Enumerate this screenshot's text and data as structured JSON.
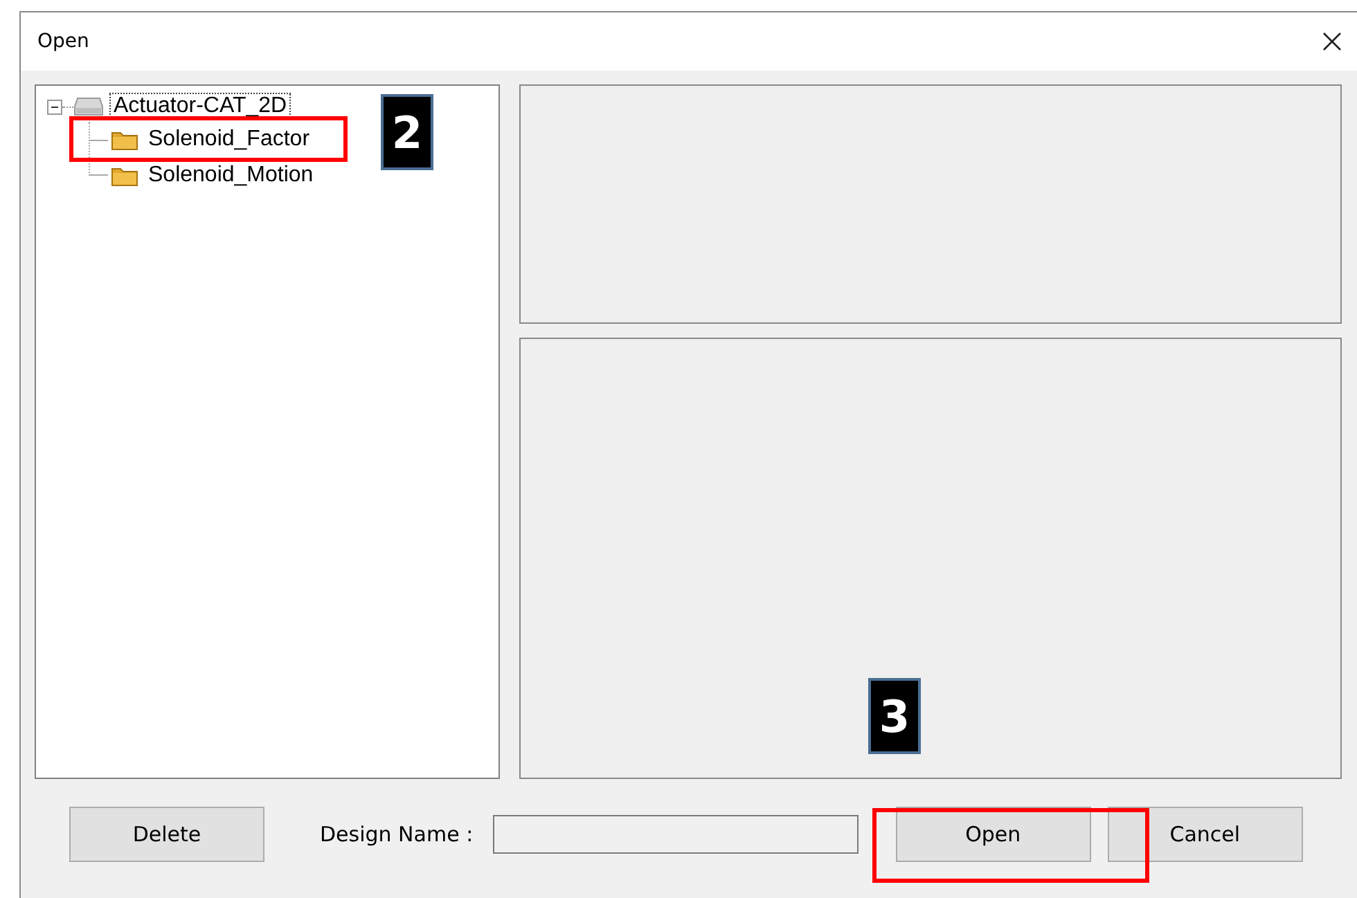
{
  "window": {
    "title": "Open"
  },
  "tree": {
    "label": "Actuator-CAT_2D",
    "expanded": true,
    "focused": true,
    "children": [
      {
        "label": "Solenoid_Factor"
      },
      {
        "label": "Solenoid_Motion"
      }
    ]
  },
  "footer": {
    "delete_button": "Delete",
    "design_name_label": "Design Name :",
    "open_button": "Open",
    "cancel_button": "Cancel"
  },
  "callouts": [
    {
      "label": "2"
    },
    {
      "label": "3"
    }
  ]
}
